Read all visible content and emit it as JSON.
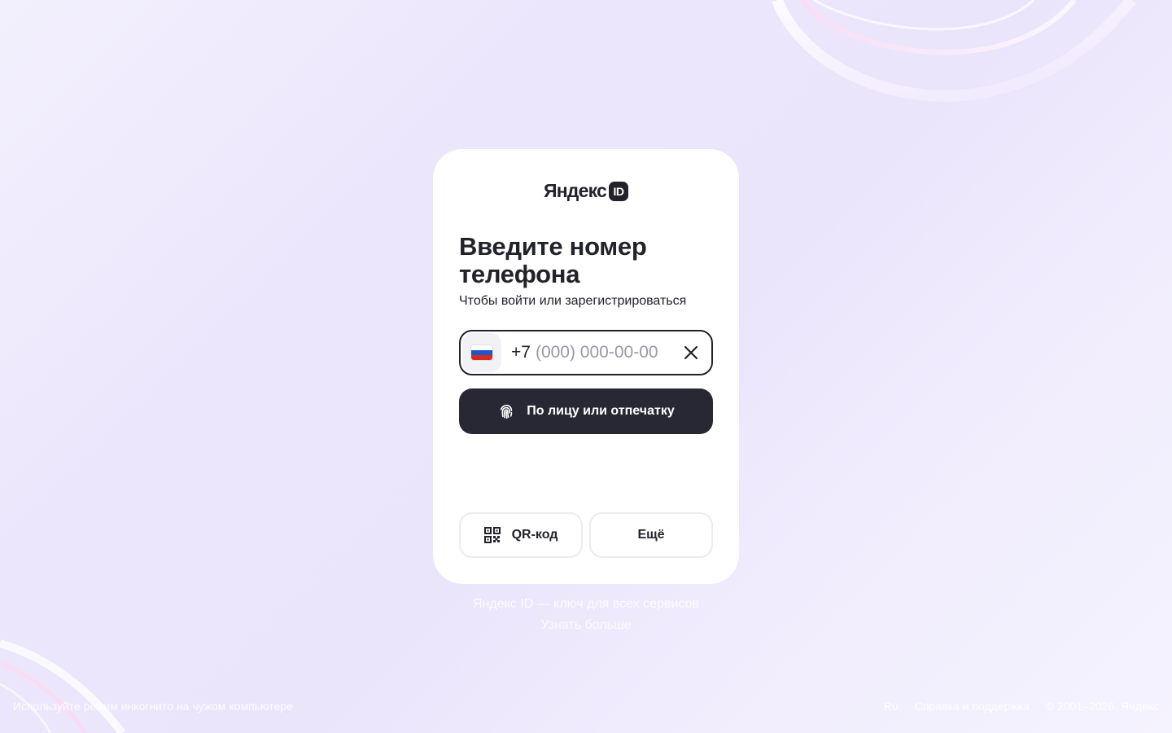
{
  "logo": {
    "text": "Яндекс",
    "badge": "ID"
  },
  "title": "Введите номер телефона",
  "subtitle": "Чтобы войти или зарегистрироваться",
  "phone": {
    "country_code": "+7",
    "placeholder": "(000) 000-00-00",
    "value": "",
    "flag_icon": "russia-flag-icon",
    "clear_icon": "close-icon"
  },
  "biometric_button": {
    "label": "По лицу или отпечатку",
    "icon": "fingerprint-icon"
  },
  "qr_button": {
    "label": "QR-код",
    "icon": "qr-code-icon"
  },
  "more_button": {
    "label": "Ещё"
  },
  "promo": {
    "line1": "Яндекс ID — ключ для всех сервисов",
    "link": "Узнать больше"
  },
  "footer": {
    "incognito_hint": "Используйте режим инкогнито на чужом компьютере",
    "language": "Ru",
    "help": "Справка и поддержка",
    "copyright": "© 2001–2026, Яндекс"
  },
  "colors": {
    "primary_dark": "#282834",
    "text": "#22222b",
    "placeholder": "#9a98a6",
    "background": "#ece6fc"
  }
}
